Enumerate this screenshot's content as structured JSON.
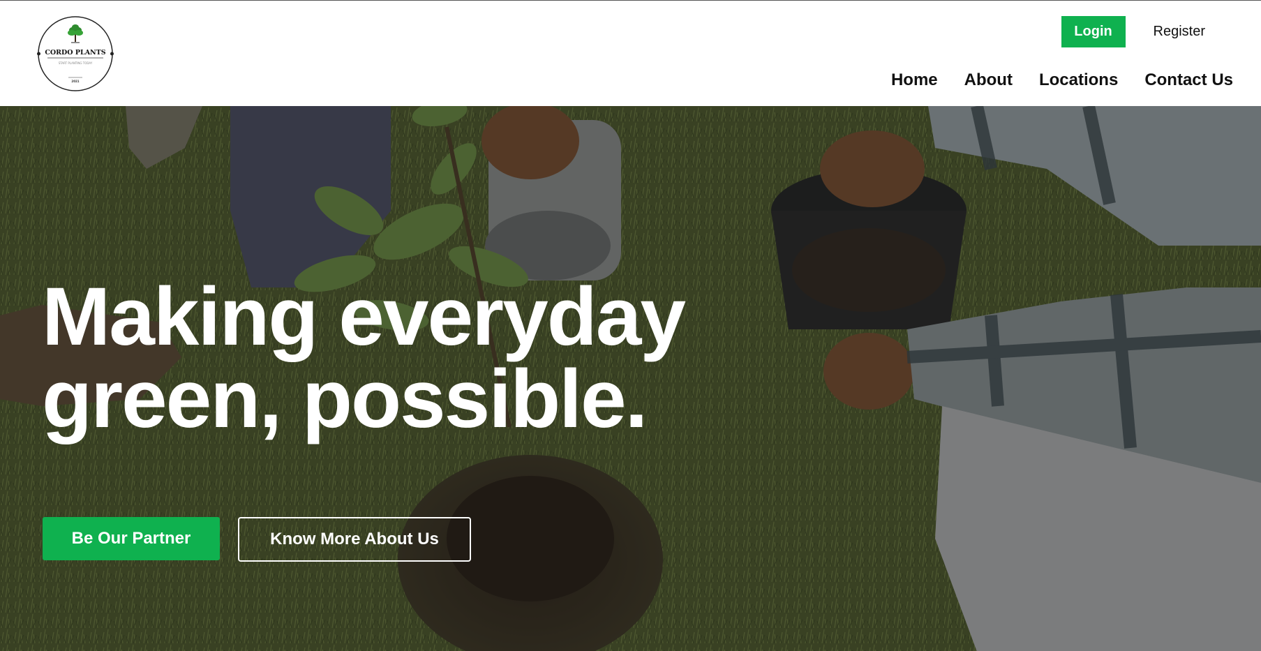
{
  "header": {
    "logo": {
      "brand": "CORDO PLANTS",
      "tagline": "START PLANTING TODAY",
      "year": "2021",
      "icon": "tree-icon"
    },
    "auth": {
      "login_label": "Login",
      "register_label": "Register"
    },
    "nav": [
      {
        "label": "Home"
      },
      {
        "label": "About"
      },
      {
        "label": "Locations"
      },
      {
        "label": "Contact Us"
      }
    ]
  },
  "hero": {
    "title_line1": "Making everyday",
    "title_line2": "green, possible.",
    "primary_cta": "Be Our Partner",
    "secondary_cta": "Know More About Us"
  },
  "colors": {
    "accent": "#0fb14f",
    "text_dark": "#111111",
    "overlay": "#1a1a14"
  }
}
